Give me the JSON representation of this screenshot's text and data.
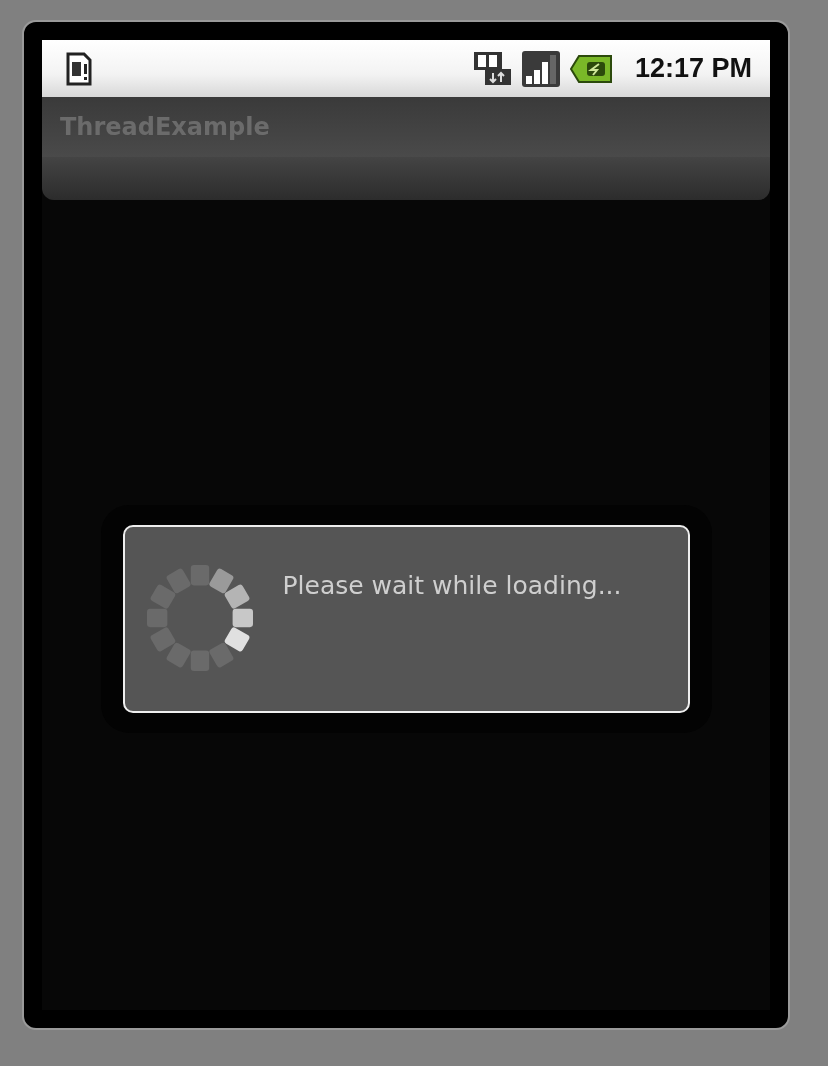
{
  "status_bar": {
    "time": "12:17 PM"
  },
  "app_bar": {
    "title": "ThreadExample"
  },
  "progress_dialog": {
    "message": "Please wait while loading..."
  }
}
